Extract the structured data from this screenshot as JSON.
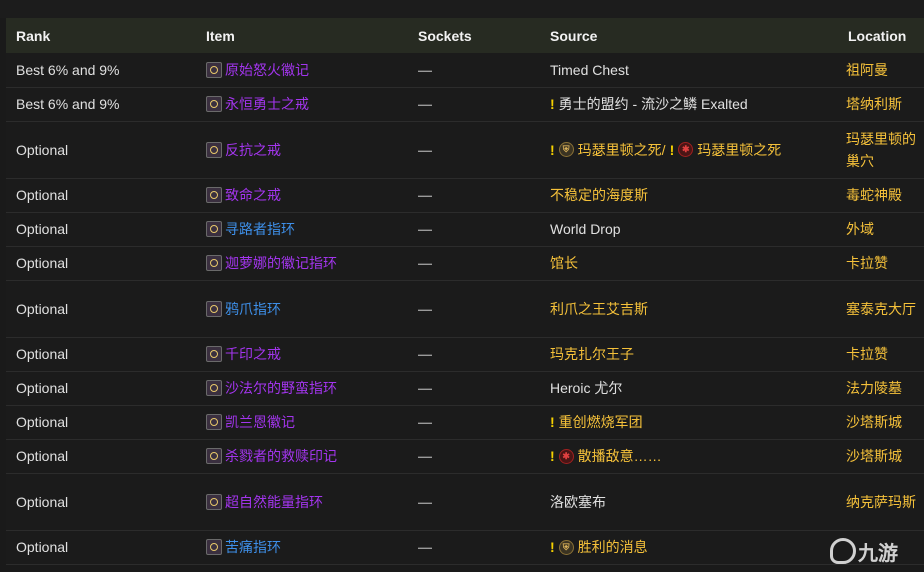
{
  "table": {
    "headers": {
      "rank": "Rank",
      "item": "Item",
      "sockets": "Sockets",
      "source": "Source",
      "location": "Location"
    },
    "rows": [
      {
        "rank": "Best 6% and 9%",
        "item": "原始怒火徽记",
        "item_color": "purple",
        "sockets": "—",
        "source_parts": [
          {
            "t": "text",
            "v": "Timed Chest"
          }
        ],
        "source_color": "white",
        "location": "祖阿曼"
      },
      {
        "rank": "Best 6% and 9%",
        "item": "永恒勇士之戒",
        "item_color": "purple",
        "sockets": "—",
        "source_parts": [
          {
            "t": "bang"
          },
          {
            "t": "text",
            "v": "勇士的盟约 - 流沙之鳞 Exalted"
          }
        ],
        "source_color": "white",
        "location": "塔纳利斯"
      },
      {
        "rank": "Optional",
        "item": "反抗之戒",
        "item_color": "purple",
        "sockets": "—",
        "source_parts": [
          {
            "t": "bang"
          },
          {
            "t": "alliance"
          },
          {
            "t": "text",
            "v": "玛瑟里顿之死/"
          },
          {
            "t": "bang"
          },
          {
            "t": "horde"
          },
          {
            "t": "text",
            "v": "玛瑟里顿之死"
          }
        ],
        "source_color": "gold",
        "location": "玛瑟里顿的巢穴"
      },
      {
        "rank": "Optional",
        "item": "致命之戒",
        "item_color": "purple",
        "sockets": "—",
        "source_parts": [
          {
            "t": "text",
            "v": "不稳定的海度斯"
          }
        ],
        "source_color": "gold",
        "location": "毒蛇神殿"
      },
      {
        "rank": "Optional",
        "item": "寻路者指环",
        "item_color": "blue",
        "sockets": "—",
        "source_parts": [
          {
            "t": "text",
            "v": "World Drop"
          }
        ],
        "source_color": "white",
        "location": "外域"
      },
      {
        "rank": "Optional",
        "item": "迦萝娜的徽记指环",
        "item_color": "purple",
        "sockets": "—",
        "source_parts": [
          {
            "t": "text",
            "v": "馆长"
          }
        ],
        "source_color": "gold",
        "location": "卡拉赞"
      },
      {
        "rank": "Optional",
        "item": "鸦爪指环",
        "item_color": "blue",
        "sockets": "—",
        "source_parts": [
          {
            "t": "text",
            "v": "利爪之王艾吉斯"
          }
        ],
        "source_color": "gold",
        "location": "塞泰克大厅"
      },
      {
        "rank": "Optional",
        "item": "千印之戒",
        "item_color": "purple",
        "sockets": "—",
        "source_parts": [
          {
            "t": "text",
            "v": "玛克扎尔王子"
          }
        ],
        "source_color": "gold",
        "location": "卡拉赞"
      },
      {
        "rank": "Optional",
        "item": "沙法尔的野蛮指环",
        "item_color": "purple",
        "sockets": "—",
        "source_parts": [
          {
            "t": "text",
            "v": "Heroic 尤尔"
          }
        ],
        "source_color": "white",
        "location": "法力陵墓"
      },
      {
        "rank": "Optional",
        "item": "凯兰恩徽记",
        "item_color": "purple",
        "sockets": "—",
        "source_parts": [
          {
            "t": "bang"
          },
          {
            "t": "text",
            "v": "重创燃烧军团"
          }
        ],
        "source_color": "gold",
        "location": "沙塔斯城"
      },
      {
        "rank": "Optional",
        "item": "杀戮者的救赎印记",
        "item_color": "purple",
        "sockets": "—",
        "source_parts": [
          {
            "t": "bang"
          },
          {
            "t": "horde"
          },
          {
            "t": "text",
            "v": "散播敌意……"
          }
        ],
        "source_color": "gold",
        "location": "沙塔斯城"
      },
      {
        "rank": "Optional",
        "item": "超自然能量指环",
        "item_color": "purple",
        "sockets": "—",
        "source_parts": [
          {
            "t": "text",
            "v": "洛欧塞布"
          }
        ],
        "source_color": "white",
        "location": "纳克萨玛斯"
      },
      {
        "rank": "Optional",
        "item": "苦痛指环",
        "item_color": "blue",
        "sockets": "—",
        "source_parts": [
          {
            "t": "bang"
          },
          {
            "t": "alliance"
          },
          {
            "t": "text",
            "v": "胜利的消息"
          }
        ],
        "source_color": "gold",
        "location": ""
      }
    ]
  },
  "watermark": {
    "text": "九游"
  }
}
